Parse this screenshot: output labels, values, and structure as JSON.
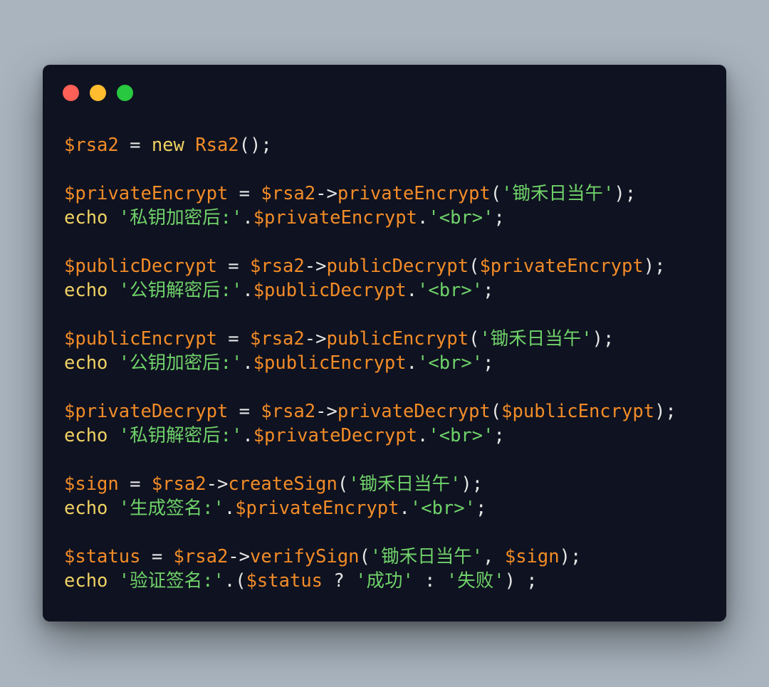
{
  "window": {
    "traffic_lights": [
      {
        "name": "close",
        "color": "#fe5f57"
      },
      {
        "name": "minimize",
        "color": "#febc2e"
      },
      {
        "name": "zoom",
        "color": "#28c840"
      }
    ]
  },
  "colors": {
    "background": "#a9b4bf",
    "editor": "#0f1220",
    "variable": "#f28c28",
    "keyword": "#f0d264",
    "string": "#6fd26a",
    "punctuation": "#e6e6e6"
  },
  "code_lines": [
    [
      {
        "t": "var",
        "v": "$rsa2"
      },
      {
        "t": "punc",
        "v": " = "
      },
      {
        "t": "kw",
        "v": "new"
      },
      {
        "t": "punc",
        "v": " "
      },
      {
        "t": "fn",
        "v": "Rsa2"
      },
      {
        "t": "punc",
        "v": "();"
      }
    ],
    [],
    [
      {
        "t": "var",
        "v": "$privateEncrypt"
      },
      {
        "t": "punc",
        "v": " = "
      },
      {
        "t": "var",
        "v": "$rsa2"
      },
      {
        "t": "punc",
        "v": "->"
      },
      {
        "t": "fn",
        "v": "privateEncrypt"
      },
      {
        "t": "punc",
        "v": "("
      },
      {
        "t": "str",
        "v": "'锄禾日当午'"
      },
      {
        "t": "punc",
        "v": ");"
      }
    ],
    [
      {
        "t": "kw",
        "v": "echo"
      },
      {
        "t": "punc",
        "v": " "
      },
      {
        "t": "str",
        "v": "'私钥加密后:'"
      },
      {
        "t": "punc",
        "v": "."
      },
      {
        "t": "var",
        "v": "$privateEncrypt"
      },
      {
        "t": "punc",
        "v": "."
      },
      {
        "t": "str",
        "v": "'<br>'"
      },
      {
        "t": "punc",
        "v": ";"
      }
    ],
    [],
    [
      {
        "t": "var",
        "v": "$publicDecrypt"
      },
      {
        "t": "punc",
        "v": " = "
      },
      {
        "t": "var",
        "v": "$rsa2"
      },
      {
        "t": "punc",
        "v": "->"
      },
      {
        "t": "fn",
        "v": "publicDecrypt"
      },
      {
        "t": "punc",
        "v": "("
      },
      {
        "t": "var",
        "v": "$privateEncrypt"
      },
      {
        "t": "punc",
        "v": ");"
      }
    ],
    [
      {
        "t": "kw",
        "v": "echo"
      },
      {
        "t": "punc",
        "v": " "
      },
      {
        "t": "str",
        "v": "'公钥解密后:'"
      },
      {
        "t": "punc",
        "v": "."
      },
      {
        "t": "var",
        "v": "$publicDecrypt"
      },
      {
        "t": "punc",
        "v": "."
      },
      {
        "t": "str",
        "v": "'<br>'"
      },
      {
        "t": "punc",
        "v": ";"
      }
    ],
    [],
    [
      {
        "t": "var",
        "v": "$publicEncrypt"
      },
      {
        "t": "punc",
        "v": " = "
      },
      {
        "t": "var",
        "v": "$rsa2"
      },
      {
        "t": "punc",
        "v": "->"
      },
      {
        "t": "fn",
        "v": "publicEncrypt"
      },
      {
        "t": "punc",
        "v": "("
      },
      {
        "t": "str",
        "v": "'锄禾日当午'"
      },
      {
        "t": "punc",
        "v": ");"
      }
    ],
    [
      {
        "t": "kw",
        "v": "echo"
      },
      {
        "t": "punc",
        "v": " "
      },
      {
        "t": "str",
        "v": "'公钥加密后:'"
      },
      {
        "t": "punc",
        "v": "."
      },
      {
        "t": "var",
        "v": "$publicEncrypt"
      },
      {
        "t": "punc",
        "v": "."
      },
      {
        "t": "str",
        "v": "'<br>'"
      },
      {
        "t": "punc",
        "v": ";"
      }
    ],
    [],
    [
      {
        "t": "var",
        "v": "$privateDecrypt"
      },
      {
        "t": "punc",
        "v": " = "
      },
      {
        "t": "var",
        "v": "$rsa2"
      },
      {
        "t": "punc",
        "v": "->"
      },
      {
        "t": "fn",
        "v": "privateDecrypt"
      },
      {
        "t": "punc",
        "v": "("
      },
      {
        "t": "var",
        "v": "$publicEncrypt"
      },
      {
        "t": "punc",
        "v": ");"
      }
    ],
    [
      {
        "t": "kw",
        "v": "echo"
      },
      {
        "t": "punc",
        "v": " "
      },
      {
        "t": "str",
        "v": "'私钥解密后:'"
      },
      {
        "t": "punc",
        "v": "."
      },
      {
        "t": "var",
        "v": "$privateDecrypt"
      },
      {
        "t": "punc",
        "v": "."
      },
      {
        "t": "str",
        "v": "'<br>'"
      },
      {
        "t": "punc",
        "v": ";"
      }
    ],
    [],
    [
      {
        "t": "var",
        "v": "$sign"
      },
      {
        "t": "punc",
        "v": " = "
      },
      {
        "t": "var",
        "v": "$rsa2"
      },
      {
        "t": "punc",
        "v": "->"
      },
      {
        "t": "fn",
        "v": "createSign"
      },
      {
        "t": "punc",
        "v": "("
      },
      {
        "t": "str",
        "v": "'锄禾日当午'"
      },
      {
        "t": "punc",
        "v": ");"
      }
    ],
    [
      {
        "t": "kw",
        "v": "echo"
      },
      {
        "t": "punc",
        "v": " "
      },
      {
        "t": "str",
        "v": "'生成签名:'"
      },
      {
        "t": "punc",
        "v": "."
      },
      {
        "t": "var",
        "v": "$privateEncrypt"
      },
      {
        "t": "punc",
        "v": "."
      },
      {
        "t": "str",
        "v": "'<br>'"
      },
      {
        "t": "punc",
        "v": ";"
      }
    ],
    [],
    [
      {
        "t": "var",
        "v": "$status"
      },
      {
        "t": "punc",
        "v": " = "
      },
      {
        "t": "var",
        "v": "$rsa2"
      },
      {
        "t": "punc",
        "v": "->"
      },
      {
        "t": "fn",
        "v": "verifySign"
      },
      {
        "t": "punc",
        "v": "("
      },
      {
        "t": "str",
        "v": "'锄禾日当午'"
      },
      {
        "t": "punc",
        "v": ", "
      },
      {
        "t": "var",
        "v": "$sign"
      },
      {
        "t": "punc",
        "v": ");"
      }
    ],
    [
      {
        "t": "kw",
        "v": "echo"
      },
      {
        "t": "punc",
        "v": " "
      },
      {
        "t": "str",
        "v": "'验证签名:'"
      },
      {
        "t": "punc",
        "v": ".("
      },
      {
        "t": "var",
        "v": "$status"
      },
      {
        "t": "punc",
        "v": " ? "
      },
      {
        "t": "str",
        "v": "'成功'"
      },
      {
        "t": "punc",
        "v": " : "
      },
      {
        "t": "str",
        "v": "'失败'"
      },
      {
        "t": "punc",
        "v": ") ;"
      }
    ]
  ]
}
